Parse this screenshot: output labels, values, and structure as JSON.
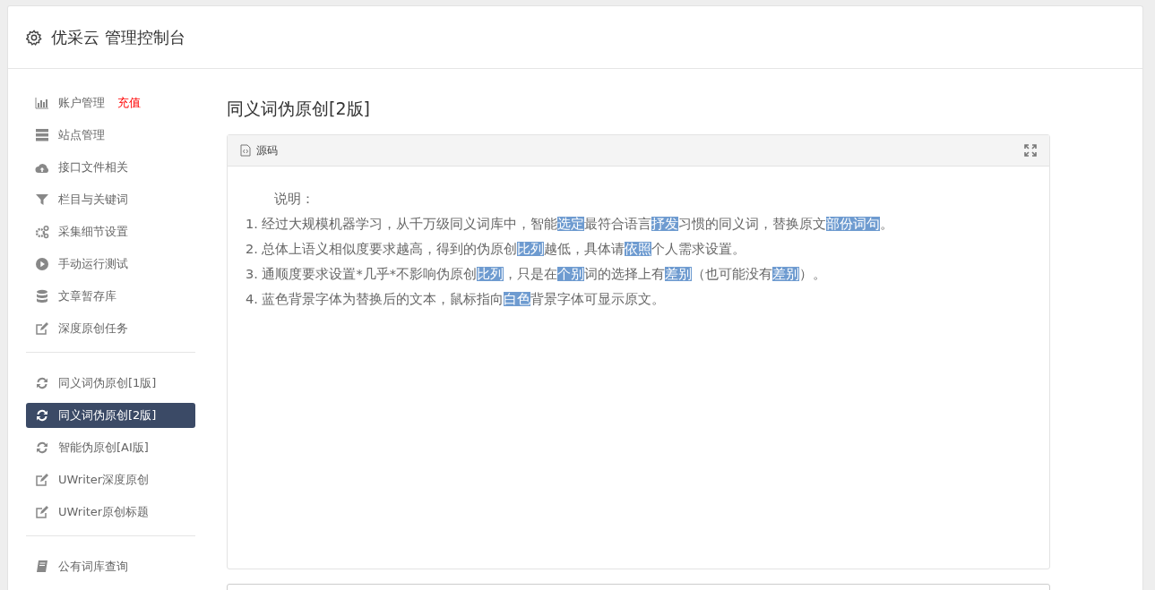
{
  "header": {
    "title": "优采云 管理控制台"
  },
  "sidebar": {
    "groups": [
      {
        "items": [
          {
            "label": "账户管理",
            "badge": "充值",
            "kind": "chart",
            "selected": false
          },
          {
            "label": "站点管理",
            "kind": "server",
            "selected": false
          },
          {
            "label": "接口文件相关",
            "kind": "cloud",
            "selected": false
          },
          {
            "label": "栏目与关键词",
            "kind": "filter",
            "selected": false
          },
          {
            "label": "采集细节设置",
            "kind": "gears",
            "selected": false
          },
          {
            "label": "手动运行测试",
            "kind": "play",
            "selected": false
          },
          {
            "label": "文章暂存库",
            "kind": "database",
            "selected": false
          },
          {
            "label": "深度原创任务",
            "kind": "edit",
            "selected": false
          }
        ]
      },
      {
        "items": [
          {
            "label": "同义词伪原创[1版]",
            "kind": "refresh",
            "selected": false
          },
          {
            "label": "同义词伪原创[2版]",
            "kind": "refresh",
            "selected": true
          },
          {
            "label": "智能伪原创[AI版]",
            "kind": "refresh",
            "selected": false
          },
          {
            "label": "UWriter深度原创",
            "kind": "edit",
            "selected": false
          },
          {
            "label": "UWriter原创标题",
            "kind": "edit",
            "selected": false
          }
        ]
      },
      {
        "items": [
          {
            "label": "公有词库查询",
            "kind": "book",
            "selected": false
          }
        ]
      }
    ]
  },
  "main": {
    "title": "同义词伪原创[2版]",
    "editor": {
      "tab": "源码",
      "heading": "说明：",
      "lines": [
        [
          {
            "text": "1. 经过大规模机器学习，从千万级同义词库中，智能",
            "replaced": false
          },
          {
            "text": "选定",
            "replaced": true
          },
          {
            "text": "最符合语言",
            "replaced": false
          },
          {
            "text": "抒发",
            "replaced": true
          },
          {
            "text": "习惯的同义词，替换原文",
            "replaced": false
          },
          {
            "text": "部份",
            "replaced": true
          },
          {
            "text": "词句",
            "replaced": true
          },
          {
            "text": "。",
            "replaced": false
          }
        ],
        [
          {
            "text": "2. 总体上语义相似度要求越高，得到的伪原创",
            "replaced": false
          },
          {
            "text": "比列",
            "replaced": true
          },
          {
            "text": "越低，具体请",
            "replaced": false
          },
          {
            "text": "依照",
            "replaced": true
          },
          {
            "text": "个人需求设置。",
            "replaced": false
          }
        ],
        [
          {
            "text": "3. 通顺度要求设置*几乎*不影响伪原创",
            "replaced": false
          },
          {
            "text": "比列",
            "replaced": true
          },
          {
            "text": "，只是在",
            "replaced": false
          },
          {
            "text": "个别",
            "replaced": true
          },
          {
            "text": "词的选择上有",
            "replaced": false
          },
          {
            "text": "差别",
            "replaced": true
          },
          {
            "text": "（也可能没有",
            "replaced": false
          },
          {
            "text": "差别",
            "replaced": true
          },
          {
            "text": "）。",
            "replaced": false
          }
        ],
        [
          {
            "text": "4. 蓝色背景字体为替换后的文本，鼠标指向",
            "replaced": false
          },
          {
            "text": "白色",
            "replaced": true
          },
          {
            "text": "背景字体可显示原文。",
            "replaced": false
          }
        ]
      ]
    }
  }
}
